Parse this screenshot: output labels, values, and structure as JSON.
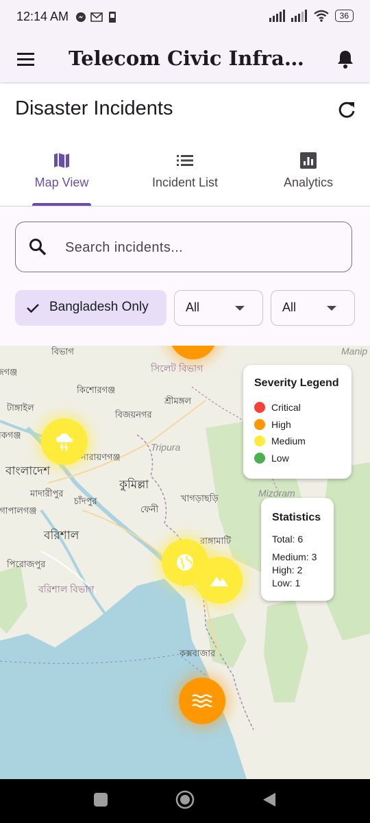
{
  "status_bar": {
    "time": "12:14 AM",
    "battery": "36"
  },
  "app_bar": {
    "title": "Telecom Civic Infrastr..."
  },
  "page": {
    "title": "Disaster Incidents"
  },
  "tabs": [
    {
      "label": "Map View",
      "icon": "map-icon",
      "active": true
    },
    {
      "label": "Incident List",
      "icon": "list-icon",
      "active": false
    },
    {
      "label": "Analytics",
      "icon": "analytics-icon",
      "active": false
    }
  ],
  "filters": {
    "search_placeholder": "Search incidents...",
    "bangladesh_chip": "Bangladesh Only",
    "dropdown1_value": "All",
    "dropdown2_value": "All"
  },
  "map": {
    "places": {
      "sylhet_div": "সিলেট বিভাগ",
      "kishoreganj": "কিশোরগঞ্জ",
      "sreemangal": "শ্রীমঙ্গল",
      "tangail": "টাঙ্গাইল",
      "bijoynagar": "বিজয়নগর",
      "tripura": "Tripura",
      "narayanganj": "নারায়ণগঞ্জ",
      "bangladesh": "বাংলাদেশ",
      "cumilla": "কুমিল্লা",
      "madaripur": "মাদারীপুর",
      "chandpur": "চাঁদপুর",
      "feni": "ফেনী",
      "khagrachhari": "খাগড়াছড়ি",
      "mizoram": "Mizoram",
      "barishal": "বরিশাল",
      "rangamati": "রাঙ্গামাটি",
      "pirojpur": "পিরোজপুর",
      "barishal_div": "বরিশাল বিভাগ",
      "coxsbazar": "কক্সবাজার",
      "manipur": "Manip",
      "top_left_div": "বিভাগ",
      "jamalganj": "জগঞ্জ",
      "gazipur_edge": "নকগঞ্জ",
      "gopalganj": "গোপালগঞ্জ"
    },
    "markers": [
      {
        "severity": "High",
        "icon": "marker-top-icon"
      },
      {
        "severity": "Medium",
        "icon": "storm-icon"
      },
      {
        "severity": "Medium",
        "icon": "globe-icon"
      },
      {
        "severity": "Medium",
        "icon": "landslide-icon"
      },
      {
        "severity": "High",
        "icon": "flood-icon"
      }
    ],
    "legend": {
      "title": "Severity Legend",
      "items": [
        {
          "label": "Critical",
          "color": "#f44336"
        },
        {
          "label": "High",
          "color": "#ff9800"
        },
        {
          "label": "Medium",
          "color": "#ffeb3b"
        },
        {
          "label": "Low",
          "color": "#4caf50"
        }
      ]
    },
    "stats": {
      "title": "Statistics",
      "total": "Total: 6",
      "medium": "Medium: 3",
      "high": "High: 2",
      "low": "Low: 1"
    }
  },
  "colors": {
    "accent": "#6750a4",
    "chip_bg": "#e8def8",
    "surface": "#fdf7fe"
  }
}
